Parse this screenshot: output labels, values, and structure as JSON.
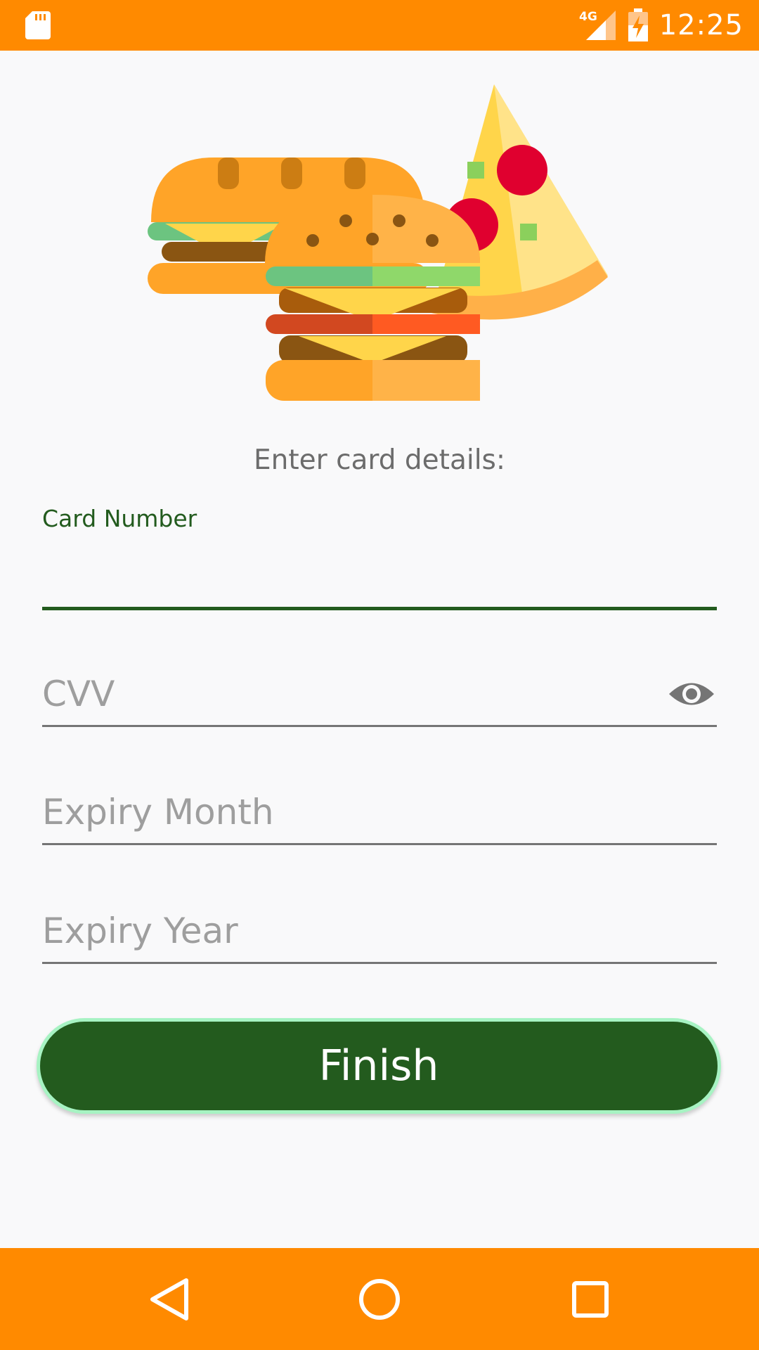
{
  "status_bar": {
    "time": "12:25",
    "network_label": "4G",
    "icons": [
      "sd-card-icon",
      "cell-signal-4g-icon",
      "battery-charging-icon"
    ]
  },
  "form": {
    "prompt": "Enter card details:",
    "card_number": {
      "label": "Card Number",
      "value": ""
    },
    "cvv": {
      "placeholder": "CVV",
      "value": ""
    },
    "expiry_month": {
      "placeholder": "Expiry Month",
      "value": ""
    },
    "expiry_year": {
      "placeholder": "Expiry Year",
      "value": ""
    },
    "finish_label": "Finish"
  },
  "nav_bar": {
    "buttons": [
      "back-icon",
      "home-icon",
      "recents-icon"
    ]
  },
  "colors": {
    "status_bar": "#ff8a00",
    "nav_bar": "#ff8a00",
    "accent_green": "#235b1e",
    "button_border": "#a7f3c3",
    "background": "#f9f9fa"
  }
}
